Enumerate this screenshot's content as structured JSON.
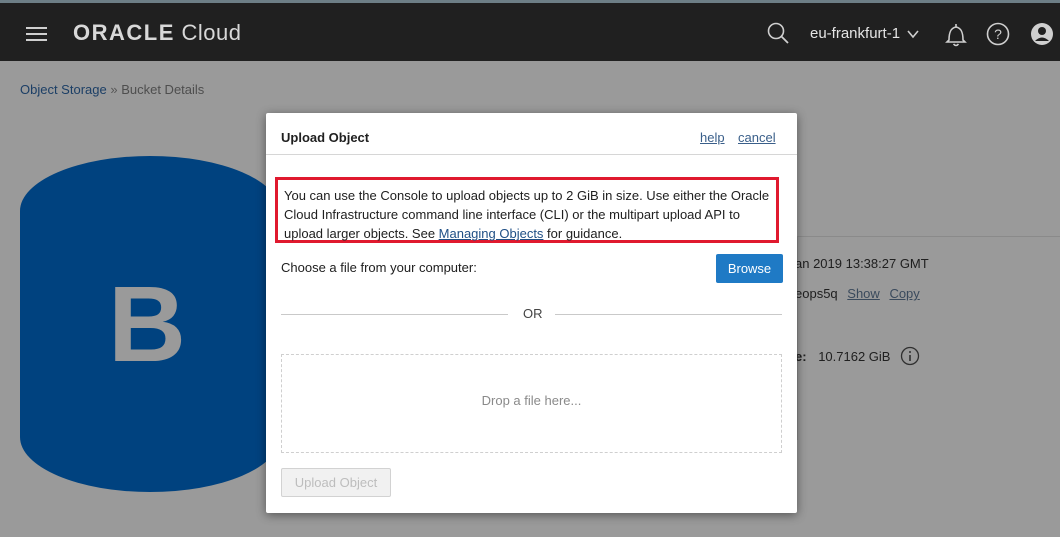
{
  "header": {
    "brand_bold": "ORACLE",
    "brand_rest": "Cloud",
    "region": "eu-frankfurt-1"
  },
  "icons": {
    "menu": "hamburger-icon",
    "search": "search-icon",
    "region_dropdown": "chevron-down-icon",
    "notifications": "bell-icon",
    "help": "help-icon",
    "profile": "user-icon",
    "info": "info-icon"
  },
  "breadcrumb": {
    "root": "Object Storage",
    "separator": "»",
    "current": "Bucket Details"
  },
  "bucket": {
    "letter": "B",
    "color": "#00427f",
    "created_partial": "an 2019 13:38:27 GMT",
    "namespace_partial": "eops5q",
    "show_label": "Show",
    "copy_label": "Copy",
    "size_label_partial": "e:",
    "size_value": "10.7162 GiB"
  },
  "dialog": {
    "title": "Upload Object",
    "help_label": "help",
    "cancel_label": "cancel",
    "notice_part1": "You can use the Console to upload objects up to 2 GiB in size. Use either the Oracle Cloud Infrastructure command line interface (CLI) or the multipart upload API to upload larger objects. See ",
    "notice_link": "Managing Objects",
    "notice_part2": " for guidance.",
    "choose_label": "Choose a file from your computer:",
    "browse_label": "Browse",
    "or_label": "OR",
    "drop_placeholder": "Drop a file here...",
    "upload_label": "Upload Object",
    "highlight_color": "#e0192e",
    "primary_color": "#1f7ac5"
  }
}
